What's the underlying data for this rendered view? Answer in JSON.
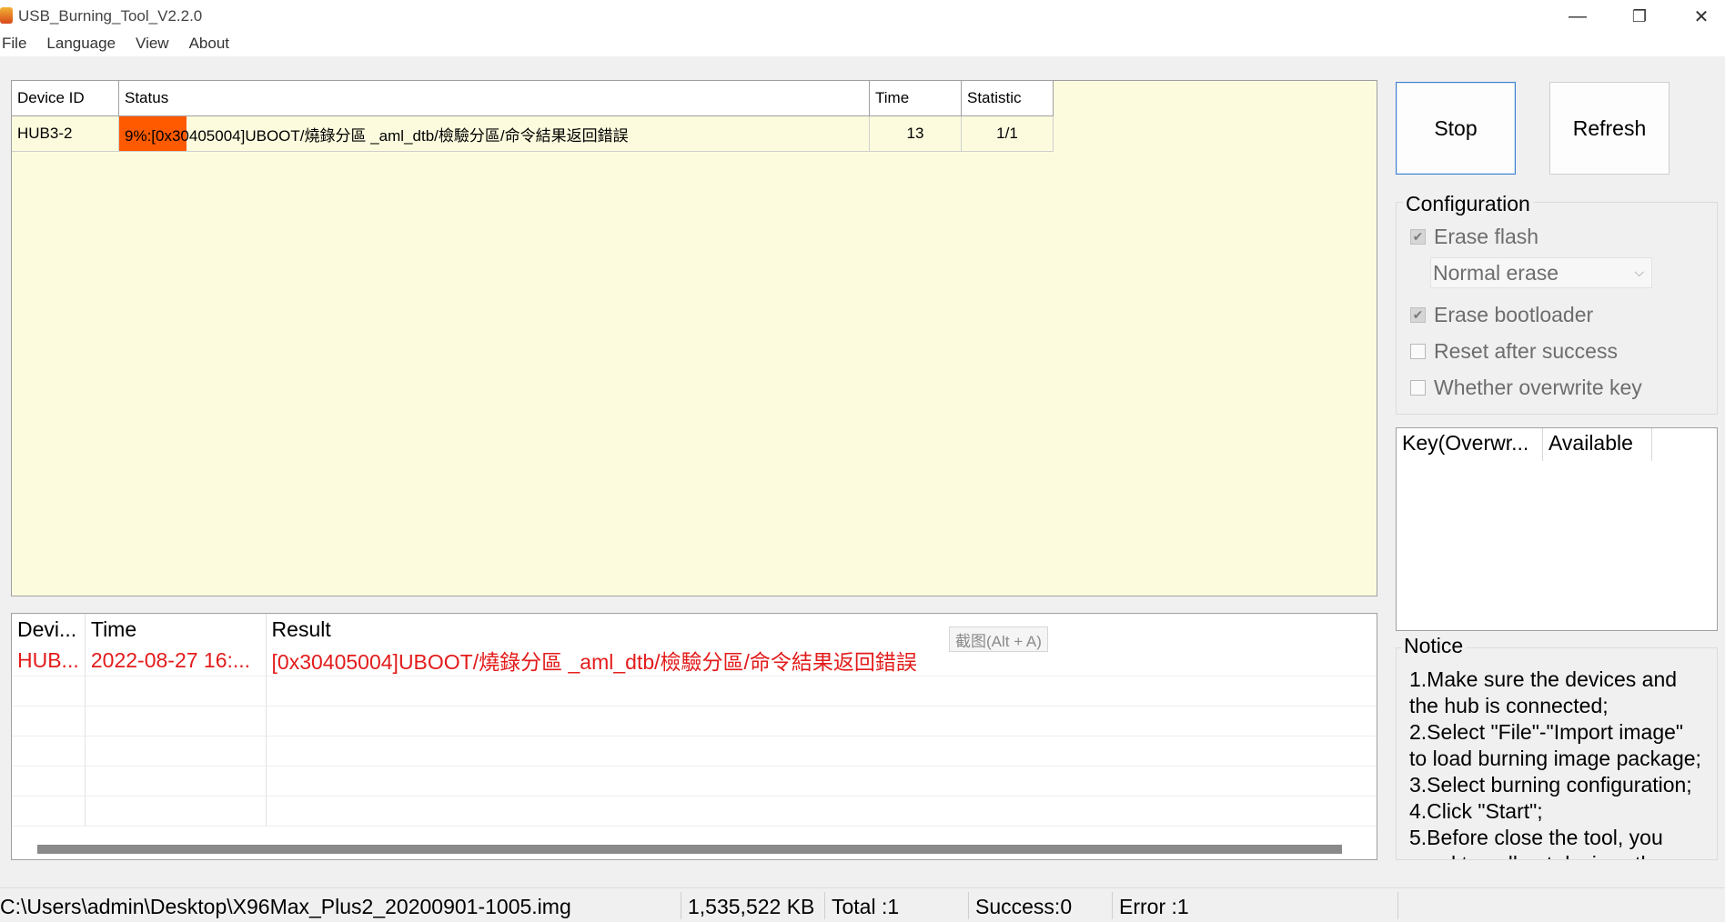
{
  "window": {
    "title": "USB_Burning_Tool_V2.2.0",
    "controls": {
      "minimize": "—",
      "restore": "❐",
      "close": "✕"
    }
  },
  "menu": [
    "File",
    "Language",
    "View",
    "About"
  ],
  "device_table": {
    "headers": [
      "Device ID",
      "Status",
      "Time",
      "Statistic"
    ],
    "rows": [
      {
        "device_id": "HUB3-2",
        "status": "9%:[0x30405004]UBOOT/燒錄分區 _aml_dtb/檢驗分區/命令結果返回錯誤",
        "progress_percent": 9,
        "time": "13",
        "statistic": "1/1"
      }
    ],
    "progress_color": "#ff5a00"
  },
  "buttons": {
    "stop": "Stop",
    "refresh": "Refresh"
  },
  "configuration": {
    "label": "Configuration",
    "erase_flash": {
      "label": "Erase flash",
      "checked": true
    },
    "erase_mode": "Normal erase",
    "erase_bootloader": {
      "label": "Erase bootloader",
      "checked": true
    },
    "reset_after_success": {
      "label": "Reset after success",
      "checked": false
    },
    "overwrite_key": {
      "label": "Whether overwrite key",
      "checked": false
    }
  },
  "key_table": {
    "headers": [
      "Key(Overwr...",
      "Available"
    ]
  },
  "notice": {
    "label": "Notice",
    "lines": [
      "1.Make sure the devices and",
      "the hub is connected;",
      "2.Select \"File\"-\"Import image\"",
      "to load burning image package;",
      "3.Select burning configuration;",
      "4.Click \"Start\";",
      "5.Before close the tool, you",
      "need to pull out devices then"
    ]
  },
  "log_table": {
    "headers": [
      "Devi...",
      "Time",
      "Result"
    ],
    "rows": [
      {
        "device": "HUB...",
        "time": "2022-08-27 16:...",
        "result": "[0x30405004]UBOOT/燒錄分區 _aml_dtb/檢驗分區/命令結果返回錯誤"
      }
    ],
    "tooltip": "截图(Alt + A)",
    "error_color": "#e31b1b"
  },
  "status_bar": {
    "path": "C:\\Users\\admin\\Desktop\\X96Max_Plus2_20200901-1005.img",
    "size": "1,535,522 KB",
    "total": "Total :1",
    "success": "Success:0",
    "error": "Error :1"
  },
  "icons": [
    "app-icon",
    "minimize-icon",
    "restore-icon",
    "close-icon",
    "checkbox-checked-icon",
    "chevron-down-icon"
  ]
}
